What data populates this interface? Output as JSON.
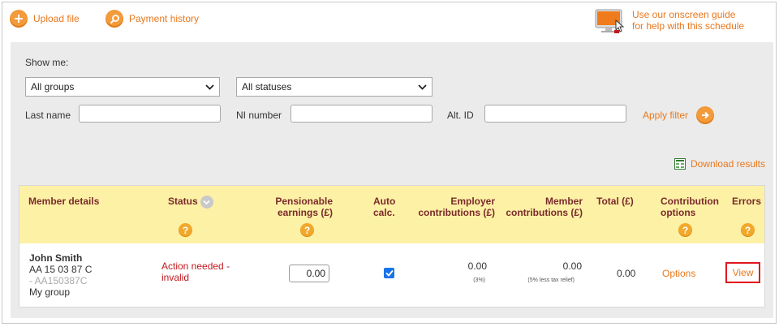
{
  "toolbar": {
    "upload_label": "Upload file",
    "payment_history_label": "Payment history",
    "guide_line1": "Use our onscreen guide",
    "guide_line2": "for help with this schedule"
  },
  "filter": {
    "show_me_label": "Show me:",
    "group_select_value": "All groups",
    "status_select_value": "All statuses",
    "last_name_label": "Last name",
    "ni_number_label": "NI number",
    "alt_id_label": "Alt. ID",
    "apply_label": "Apply filter"
  },
  "results": {
    "download_label": "Download results",
    "columns": {
      "member_details": "Member details",
      "status": "Status",
      "pensionable_1": "Pensionable",
      "pensionable_2": "earnings (£)",
      "auto_1": "Auto",
      "auto_2": "calc.",
      "employer_1": "Employer",
      "employer_2": "contributions (£)",
      "member_1": "Member",
      "member_2": "contributions (£)",
      "total": "Total (£)",
      "contrib_options_1": "Contribution",
      "contrib_options_2": "options",
      "errors": "Errors",
      "help_glyph": "?"
    },
    "rows": [
      {
        "name": "John Smith",
        "ni": "AA 15 03 87 C",
        "alt_id": "- AA150387C",
        "group": "My group",
        "status_line1": "Action needed -",
        "status_line2": "invalid",
        "earnings": "0.00",
        "auto_calc": true,
        "employer": "0.00",
        "employer_note": "(3%)",
        "member": "0.00",
        "member_note": "(5% less tax relief)",
        "total": "0.00",
        "options_label": "Options",
        "errors_label": "View"
      }
    ]
  },
  "colors": {
    "accent": "#e8781e",
    "header_bg": "#fdf1a6",
    "header_text": "#7a2b2b",
    "error_text": "#c0191e",
    "highlight_border": "#e0161e"
  }
}
